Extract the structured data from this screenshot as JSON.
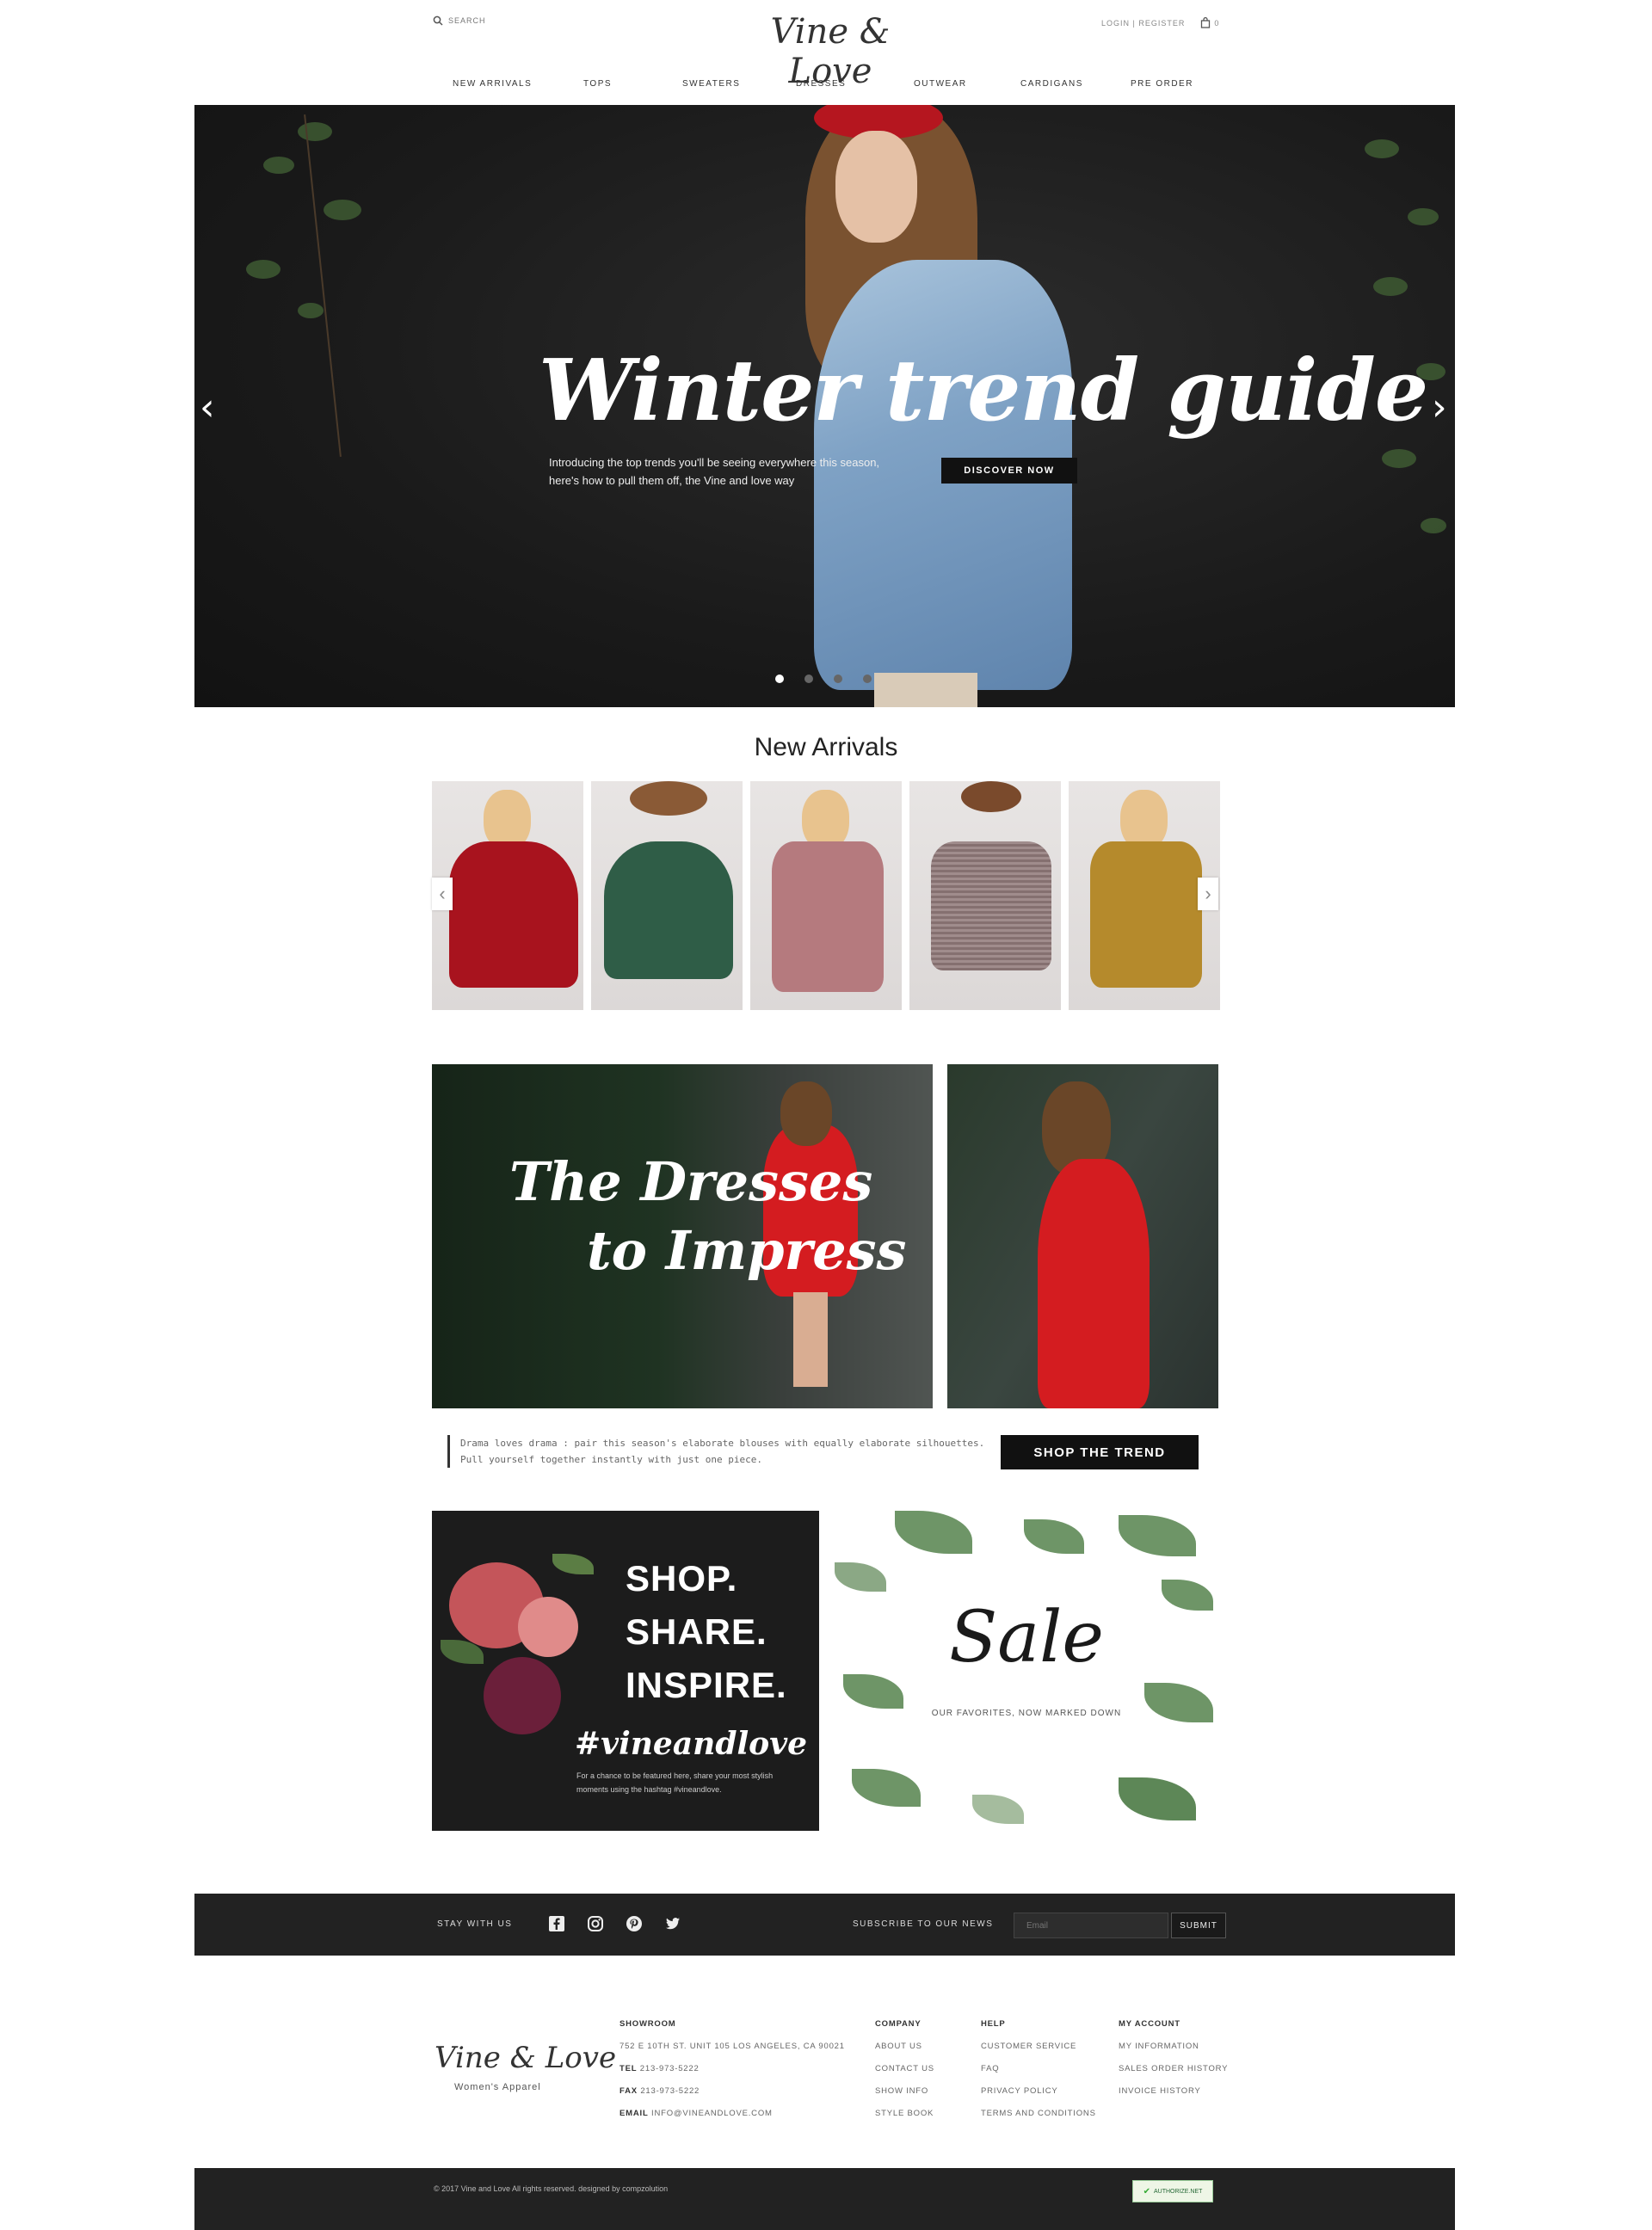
{
  "header": {
    "search_placeholder": "SEARCH",
    "logo": "Vine & Love",
    "account": "LOGIN | REGISTER",
    "cart_count": "0",
    "nav": [
      "NEW ARRIVALS",
      "TOPS",
      "SWEATERS",
      "DRESSES",
      "OUTWEAR",
      "CARDIGANS",
      "PRE ORDER"
    ]
  },
  "hero": {
    "title": "Winter trend guide",
    "body": "Introducing the top trends you'll be seeing everywhere this season, here's how to pull them off, the Vine and love way",
    "button": "DISCOVER NOW",
    "slide_count": 4,
    "active_slide": 1
  },
  "new_arrivals": {
    "title": "New Arrivals",
    "products": [
      {
        "name": "red-bell-sleeve-top",
        "color": "#a8131e"
      },
      {
        "name": "green-floral-poncho-top",
        "color": "#2f5d47"
      },
      {
        "name": "pink-off-shoulder-sweater",
        "color": "#b57a7e"
      },
      {
        "name": "grey-stripe-bell-top",
        "color": "#857070"
      },
      {
        "name": "mustard-off-shoulder-sweater",
        "color": "#b58a2c"
      }
    ]
  },
  "dresses": {
    "title_line1": "The Dresses",
    "title_line2": "to Impress",
    "quote": "Drama loves drama : pair this season's elaborate blouses with equally elaborate silhouettes. Pull yourself together instantly with just one piece.",
    "button": "SHOP THE TREND",
    "dress_color": "#d41c20"
  },
  "promo": {
    "lines": [
      "SHOP.",
      "SHARE.",
      "INSPIRE."
    ],
    "hashtag": "#vineandlove",
    "hashtag_sub": "For a chance to be featured here, share your most stylish moments using the hashtag #vineandlove.",
    "sale_title": "Sale",
    "sale_sub": "OUR FAVORITES, NOW MARKED DOWN"
  },
  "subscribe": {
    "stay": "STAY WITH US",
    "social": [
      "facebook-icon",
      "instagram-icon",
      "pinterest-icon",
      "twitter-icon"
    ],
    "title": "SUBSCRIBE TO OUR NEWS",
    "email_placeholder": "Email",
    "button": "SUBMIT"
  },
  "footer": {
    "logo": "Vine & Love",
    "tagline": "Women's Apparel",
    "showroom": {
      "heading": "SHOWROOM",
      "address": "752 E 10TH ST. UNIT 105 LOS ANGELES, CA 90021",
      "tel_label": "TEL",
      "tel": "213-973-5222",
      "fax_label": "FAX",
      "fax": "213-973-5222",
      "email_label": "EMAIL",
      "email": "INFO@VINEANDLOVE.COM"
    },
    "company": {
      "heading": "COMPANY",
      "links": [
        "ABOUT US",
        "CONTACT US",
        "SHOW INFO",
        "STYLE BOOK"
      ]
    },
    "help": {
      "heading": "HELP",
      "links": [
        "CUSTOMER SERVICE",
        "FAQ",
        "PRIVACY POLICY",
        "TERMS AND CONDITIONS"
      ]
    },
    "account": {
      "heading": "MY ACCOUNT",
      "links": [
        "MY INFORMATION",
        "SALES ORDER HISTORY",
        "INVOICE HISTORY"
      ]
    },
    "copyright": "© 2017 Vine and Love All rights reserved. designed by compzolution",
    "badge": "AUTHORIZE.NET"
  }
}
